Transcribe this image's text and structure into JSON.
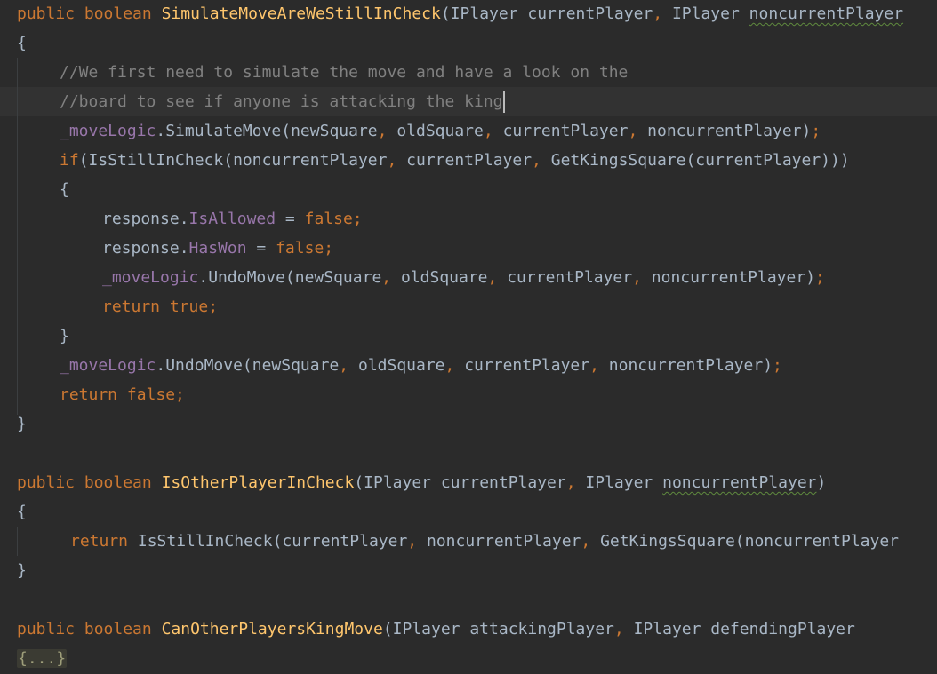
{
  "editor": {
    "lines": [
      {
        "indent": 0,
        "tokens": [
          {
            "t": "public ",
            "k": "keyword"
          },
          {
            "t": "boolean ",
            "k": "keyword"
          },
          {
            "t": "SimulateMoveAreWeStillInCheck",
            "k": "method"
          },
          {
            "t": "(IPlayer currentPlayer",
            "k": "text"
          },
          {
            "t": ", ",
            "k": "keyword"
          },
          {
            "t": "IPlayer ",
            "k": "text"
          },
          {
            "t": "noncurrentPlayer",
            "k": "text",
            "squiggle": true
          }
        ]
      },
      {
        "indent": 0,
        "tokens": [
          {
            "t": "{",
            "k": "text"
          }
        ]
      },
      {
        "indent": 4,
        "tokens": [
          {
            "t": "//We first need to simulate the move and have a look on the",
            "k": "comment"
          }
        ]
      },
      {
        "indent": 4,
        "current": true,
        "tokens": [
          {
            "t": "//board to see if anyone is attacking the king",
            "k": "comment"
          }
        ]
      },
      {
        "indent": 4,
        "tokens": [
          {
            "t": "_moveLogic",
            "k": "field"
          },
          {
            "t": ".",
            "k": "text"
          },
          {
            "t": "SimulateMove(newSquare",
            "k": "text"
          },
          {
            "t": ", ",
            "k": "keyword"
          },
          {
            "t": "oldSquare",
            "k": "text"
          },
          {
            "t": ", ",
            "k": "keyword"
          },
          {
            "t": "currentPlayer",
            "k": "text"
          },
          {
            "t": ", ",
            "k": "keyword"
          },
          {
            "t": "noncurrentPlayer)",
            "k": "text"
          },
          {
            "t": ";",
            "k": "keyword"
          }
        ]
      },
      {
        "indent": 4,
        "tokens": [
          {
            "t": "if",
            "k": "keyword"
          },
          {
            "t": "(IsStillInCheck(noncurrentPlayer",
            "k": "text"
          },
          {
            "t": ", ",
            "k": "keyword"
          },
          {
            "t": "currentPlayer",
            "k": "text"
          },
          {
            "t": ", ",
            "k": "keyword"
          },
          {
            "t": "GetKingsSquare(currentPlayer)))",
            "k": "text"
          }
        ]
      },
      {
        "indent": 4,
        "tokens": [
          {
            "t": "{",
            "k": "text"
          }
        ]
      },
      {
        "indent": 8,
        "tokens": [
          {
            "t": "response.",
            "k": "text"
          },
          {
            "t": "IsAllowed",
            "k": "field"
          },
          {
            "t": " = ",
            "k": "text"
          },
          {
            "t": "false",
            "k": "keyword"
          },
          {
            "t": ";",
            "k": "keyword"
          }
        ]
      },
      {
        "indent": 8,
        "tokens": [
          {
            "t": "response.",
            "k": "text"
          },
          {
            "t": "HasWon",
            "k": "field"
          },
          {
            "t": " = ",
            "k": "text"
          },
          {
            "t": "false",
            "k": "keyword"
          },
          {
            "t": ";",
            "k": "keyword"
          }
        ]
      },
      {
        "indent": 8,
        "tokens": [
          {
            "t": "_moveLogic",
            "k": "field"
          },
          {
            "t": ".",
            "k": "text"
          },
          {
            "t": "UndoMove(newSquare",
            "k": "text"
          },
          {
            "t": ", ",
            "k": "keyword"
          },
          {
            "t": "oldSquare",
            "k": "text"
          },
          {
            "t": ", ",
            "k": "keyword"
          },
          {
            "t": "currentPlayer",
            "k": "text"
          },
          {
            "t": ", ",
            "k": "keyword"
          },
          {
            "t": "noncurrentPlayer)",
            "k": "text"
          },
          {
            "t": ";",
            "k": "keyword"
          }
        ]
      },
      {
        "indent": 8,
        "tokens": [
          {
            "t": "return ",
            "k": "keyword"
          },
          {
            "t": "true",
            "k": "keyword"
          },
          {
            "t": ";",
            "k": "keyword"
          }
        ]
      },
      {
        "indent": 4,
        "tokens": [
          {
            "t": "}",
            "k": "text"
          }
        ]
      },
      {
        "indent": 4,
        "tokens": [
          {
            "t": "_moveLogic",
            "k": "field"
          },
          {
            "t": ".",
            "k": "text"
          },
          {
            "t": "UndoMove(newSquare",
            "k": "text"
          },
          {
            "t": ", ",
            "k": "keyword"
          },
          {
            "t": "oldSquare",
            "k": "text"
          },
          {
            "t": ", ",
            "k": "keyword"
          },
          {
            "t": "currentPlayer",
            "k": "text"
          },
          {
            "t": ", ",
            "k": "keyword"
          },
          {
            "t": "noncurrentPlayer)",
            "k": "text"
          },
          {
            "t": ";",
            "k": "keyword"
          }
        ]
      },
      {
        "indent": 4,
        "tokens": [
          {
            "t": "return ",
            "k": "keyword"
          },
          {
            "t": "false",
            "k": "keyword"
          },
          {
            "t": ";",
            "k": "keyword"
          }
        ]
      },
      {
        "indent": 0,
        "tokens": [
          {
            "t": "}",
            "k": "text"
          }
        ]
      },
      {
        "indent": 0,
        "tokens": []
      },
      {
        "indent": 0,
        "tokens": [
          {
            "t": "public ",
            "k": "keyword"
          },
          {
            "t": "boolean ",
            "k": "keyword"
          },
          {
            "t": "IsOtherPlayerInCheck",
            "k": "method"
          },
          {
            "t": "(IPlayer currentPlayer",
            "k": "text"
          },
          {
            "t": ", ",
            "k": "keyword"
          },
          {
            "t": "IPlayer ",
            "k": "text"
          },
          {
            "t": "noncurrentPlayer",
            "k": "text",
            "squiggle": true
          },
          {
            "t": ")",
            "k": "text"
          }
        ]
      },
      {
        "indent": 0,
        "tokens": [
          {
            "t": "{",
            "k": "text"
          }
        ]
      },
      {
        "indent": 5,
        "tokens": [
          {
            "t": "return ",
            "k": "keyword"
          },
          {
            "t": "IsStillInCheck(currentPlayer",
            "k": "text"
          },
          {
            "t": ", ",
            "k": "keyword"
          },
          {
            "t": "noncurrentPlayer",
            "k": "text"
          },
          {
            "t": ", ",
            "k": "keyword"
          },
          {
            "t": "GetKingsSquare(noncurrentPlayer",
            "k": "text"
          }
        ]
      },
      {
        "indent": 0,
        "tokens": [
          {
            "t": "}",
            "k": "text"
          }
        ]
      },
      {
        "indent": 0,
        "tokens": []
      },
      {
        "indent": 0,
        "tokens": [
          {
            "t": "public ",
            "k": "keyword"
          },
          {
            "t": "boolean ",
            "k": "keyword"
          },
          {
            "t": "CanOtherPlayersKingMove",
            "k": "method"
          },
          {
            "t": "(IPlayer attackingPlayer",
            "k": "text"
          },
          {
            "t": ", ",
            "k": "keyword"
          },
          {
            "t": "IPlayer defendingPlayer",
            "k": "text"
          }
        ]
      },
      {
        "indent": 0,
        "tokens": [
          {
            "t": "{...}",
            "k": "fold-box"
          }
        ]
      }
    ]
  }
}
